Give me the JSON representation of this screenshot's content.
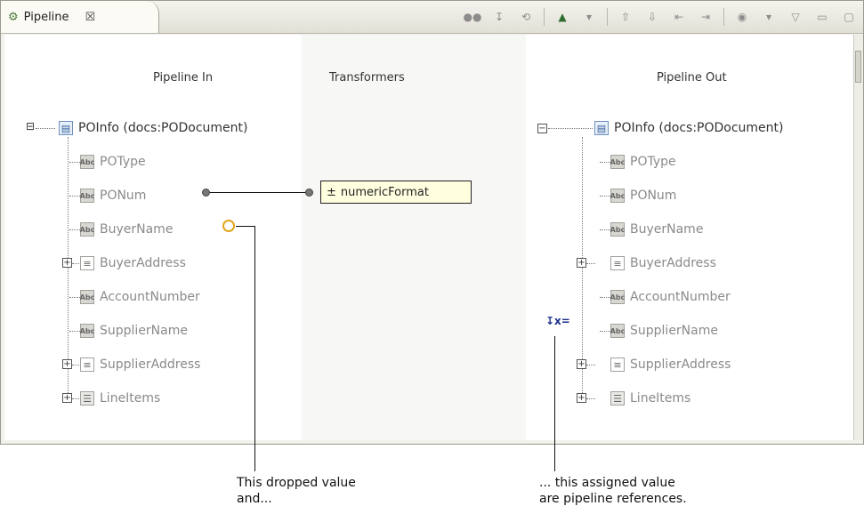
{
  "tab": {
    "label": "Pipeline",
    "close": "☒"
  },
  "toolbar": {
    "icons": [
      "hide-icon",
      "step-into-icon",
      "rewind-icon",
      "map-icon",
      "dropdown-icon",
      "move-up-icon",
      "move-down-icon",
      "shift-left-icon",
      "shift-right-icon",
      "view-icon",
      "view-dropdown-icon"
    ]
  },
  "window_controls": {
    "menu": "▽",
    "minimize": "▭",
    "maximize": "▢"
  },
  "columns": {
    "in": "Pipeline In",
    "transformers": "Transformers",
    "out": "Pipeline Out"
  },
  "pipeline_in": {
    "root": "POInfo (docs:PODocument)",
    "items": [
      {
        "label": "POType",
        "type": "Abc"
      },
      {
        "label": "PONum",
        "type": "Abc"
      },
      {
        "label": "BuyerName",
        "type": "Abc"
      },
      {
        "label": "BuyerAddress",
        "type": "doc"
      },
      {
        "label": "AccountNumber",
        "type": "Abc"
      },
      {
        "label": "SupplierName",
        "type": "Abc"
      },
      {
        "label": "SupplierAddress",
        "type": "doc"
      },
      {
        "label": "LineItems",
        "type": "list"
      }
    ]
  },
  "pipeline_out": {
    "root": "POInfo (docs:PODocument)",
    "items": [
      {
        "label": "POType",
        "type": "Abc"
      },
      {
        "label": "PONum",
        "type": "Abc"
      },
      {
        "label": "BuyerName",
        "type": "Abc"
      },
      {
        "label": "BuyerAddress",
        "type": "doc"
      },
      {
        "label": "AccountNumber",
        "type": "Abc"
      },
      {
        "label": "SupplierName",
        "type": "Abc"
      },
      {
        "label": "SupplierAddress",
        "type": "doc"
      },
      {
        "label": "LineItems",
        "type": "list"
      }
    ]
  },
  "transformer": {
    "label": "numericFormat",
    "expander": "±"
  },
  "callouts": {
    "left": {
      "line1": "This dropped value",
      "line2": "and..."
    },
    "right": {
      "line1": "... this assigned value",
      "line2": "are pipeline references."
    }
  },
  "colors": {
    "tab_bg": "#fbfaf5",
    "transformer_bg": "#ffffe0",
    "drop_icon": "#e2a51c",
    "assign_icon": "#1a2f8a"
  }
}
